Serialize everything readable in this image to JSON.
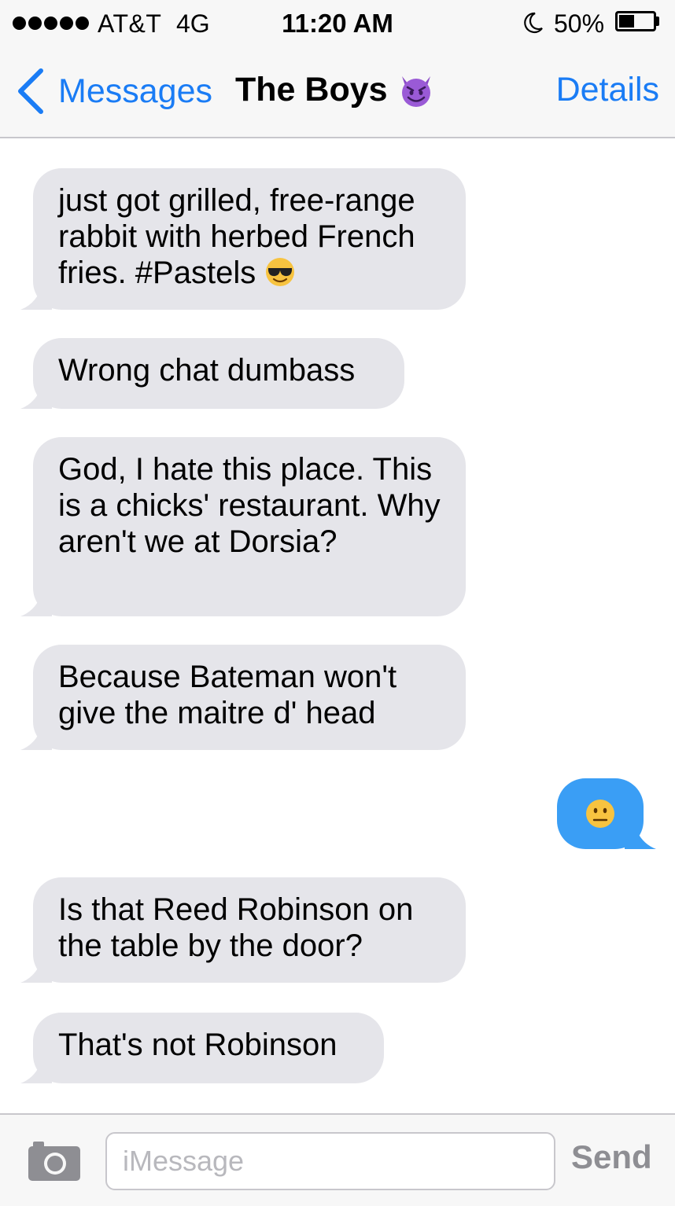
{
  "status_bar": {
    "carrier": "AT&T",
    "network": "4G",
    "time": "11:20 AM",
    "battery_percent": "50%",
    "battery_level": 0.5,
    "signal_bars": 5
  },
  "nav": {
    "back_label": "Messages",
    "title": "The Boys",
    "title_icon": "smiling-devil-icon",
    "details_label": "Details"
  },
  "messages": [
    {
      "direction": "incoming",
      "text": "just got grilled, free-range rabbit with herbed French fries. #Pastels",
      "emoji": "sunglasses-face-icon"
    },
    {
      "direction": "incoming",
      "text": "Wrong chat dumbass"
    },
    {
      "direction": "incoming",
      "text": "God, I hate this place. This is a chicks' restaurant. Why aren't we at Dorsia?"
    },
    {
      "direction": "incoming",
      "text": "Because Bateman won't give the maitre d' head"
    },
    {
      "direction": "outgoing",
      "text": "",
      "emoji": "neutral-face-icon"
    },
    {
      "direction": "incoming",
      "text": "Is that Reed Robinson on the table by the door?"
    },
    {
      "direction": "incoming",
      "text": "That's not Robinson"
    }
  ],
  "composer": {
    "placeholder": "iMessage",
    "value": "",
    "send_label": "Send",
    "camera_icon": "camera-icon"
  },
  "colors": {
    "accent": "#1a7cf5",
    "incoming_bubble": "#e5e5ea",
    "outgoing_bubble": "#3a9ef5",
    "bar_background": "#f7f7f7"
  }
}
